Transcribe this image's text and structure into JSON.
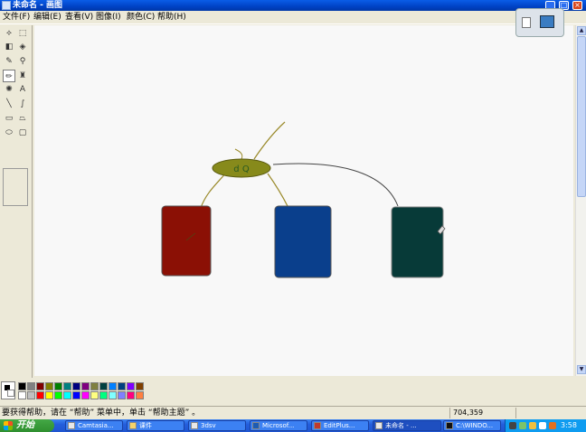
{
  "window": {
    "title": "未命名 - 画图",
    "min_glyph": "_",
    "max_glyph": "□",
    "close_glyph": "×"
  },
  "menu": [
    {
      "label": "文件(F)"
    },
    {
      "label": "编辑(E)"
    },
    {
      "label": "查看(V)"
    },
    {
      "label": "图像(I)"
    },
    {
      "label": "颜色(C)"
    },
    {
      "label": "帮助(H)"
    }
  ],
  "toolbox": {
    "tools": [
      {
        "name": "free-select",
        "glyph": "⟡"
      },
      {
        "name": "rect-select",
        "glyph": "⬚"
      },
      {
        "name": "eraser",
        "glyph": "◧"
      },
      {
        "name": "fill",
        "glyph": "◈"
      },
      {
        "name": "pick-color",
        "glyph": "✎"
      },
      {
        "name": "magnifier",
        "glyph": "⚲"
      },
      {
        "name": "pencil",
        "glyph": "✏"
      },
      {
        "name": "brush",
        "glyph": "♜"
      },
      {
        "name": "airbrush",
        "glyph": "✺"
      },
      {
        "name": "text",
        "glyph": "A"
      },
      {
        "name": "line",
        "glyph": "╲"
      },
      {
        "name": "curve",
        "glyph": "∫"
      },
      {
        "name": "rectangle",
        "glyph": "▭"
      },
      {
        "name": "polygon",
        "glyph": "⏢"
      },
      {
        "name": "ellipse",
        "glyph": "⬭"
      },
      {
        "name": "rounded-rect",
        "glyph": "▢"
      }
    ],
    "active_tool": "pencil"
  },
  "drawing": {
    "node_label": "d Q",
    "node_color": "#878a1b",
    "box_colors": [
      "#8b1005",
      "#0a3f8c",
      "#073a38"
    ],
    "line_color": "#9a8a2a"
  },
  "palette": {
    "top_row": [
      "#000000",
      "#808080",
      "#800000",
      "#808000",
      "#008000",
      "#008080",
      "#000080",
      "#800080",
      "#808040",
      "#004040",
      "#0080ff",
      "#004080",
      "#8000ff",
      "#804000"
    ],
    "bottom_row": [
      "#ffffff",
      "#c0c0c0",
      "#ff0000",
      "#ffff00",
      "#00ff00",
      "#00ffff",
      "#0000ff",
      "#ff00ff",
      "#ffff80",
      "#00ff80",
      "#80ffff",
      "#8080ff",
      "#ff0080",
      "#ff8040"
    ]
  },
  "status": {
    "help_text": "要获得帮助，请在 “帮助” 菜单中，单击 “帮助主题” 。",
    "coords": "704,359"
  },
  "taskbar": {
    "start_label": "开始",
    "buttons": [
      {
        "label": "Camtasia..."
      },
      {
        "label": "课件"
      },
      {
        "label": "3dsv"
      },
      {
        "label": "Microsof..."
      },
      {
        "label": "EditPlus..."
      },
      {
        "label": "未命名 - ..."
      },
      {
        "label": "C:\\WINDO..."
      }
    ],
    "clock": "3:58"
  }
}
